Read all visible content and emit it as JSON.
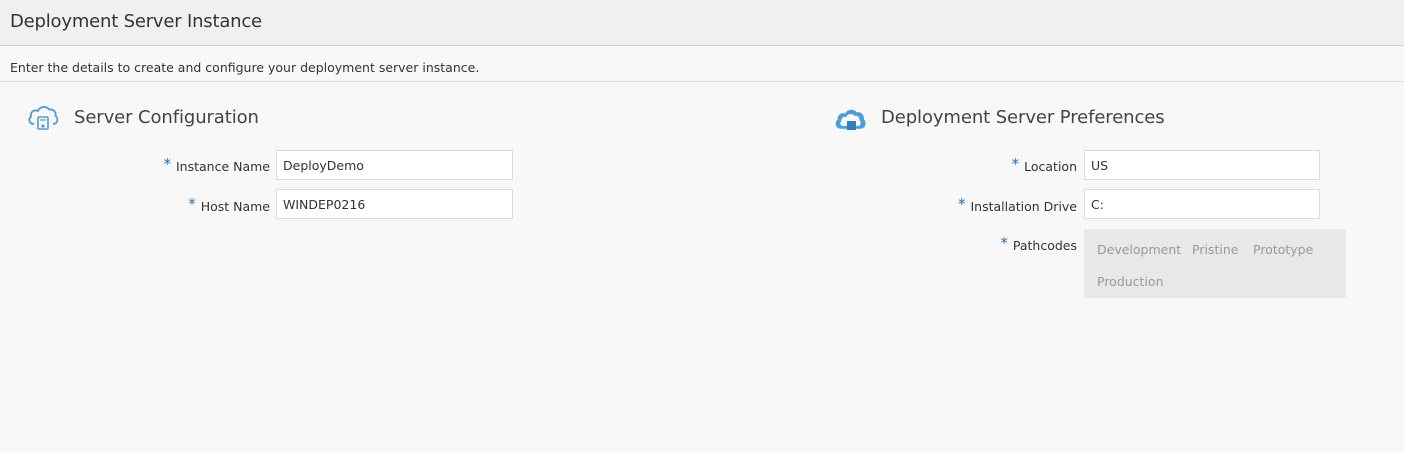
{
  "header": {
    "title": "Deployment Server Instance"
  },
  "subtitle": "Enter the details to create and configure your deployment server instance.",
  "server_configuration": {
    "title": "Server Configuration",
    "icon": "cloud-server-icon",
    "fields": [
      {
        "label": "Instance Name",
        "value": "DeployDemo",
        "required": "*"
      },
      {
        "label": "Host Name",
        "value": "WINDEP0216",
        "required": "*"
      }
    ]
  },
  "deployment_preferences": {
    "title": "Deployment Server Preferences",
    "icon": "cloud-database-icon",
    "fields": [
      {
        "label": "Location",
        "value": "US",
        "required": "*"
      },
      {
        "label": "Installation Drive",
        "value": "C:",
        "required": "*"
      }
    ],
    "pathcodes": {
      "label": "Pathcodes",
      "required": "*",
      "options": [
        "Development",
        "Pristine",
        "Prototype",
        "Production"
      ]
    }
  },
  "colors": {
    "accent": "#1f6fb5",
    "icon_blue": "#4a9fd8",
    "background": "#f8f8f8",
    "header_bg": "#f0f0f0"
  }
}
